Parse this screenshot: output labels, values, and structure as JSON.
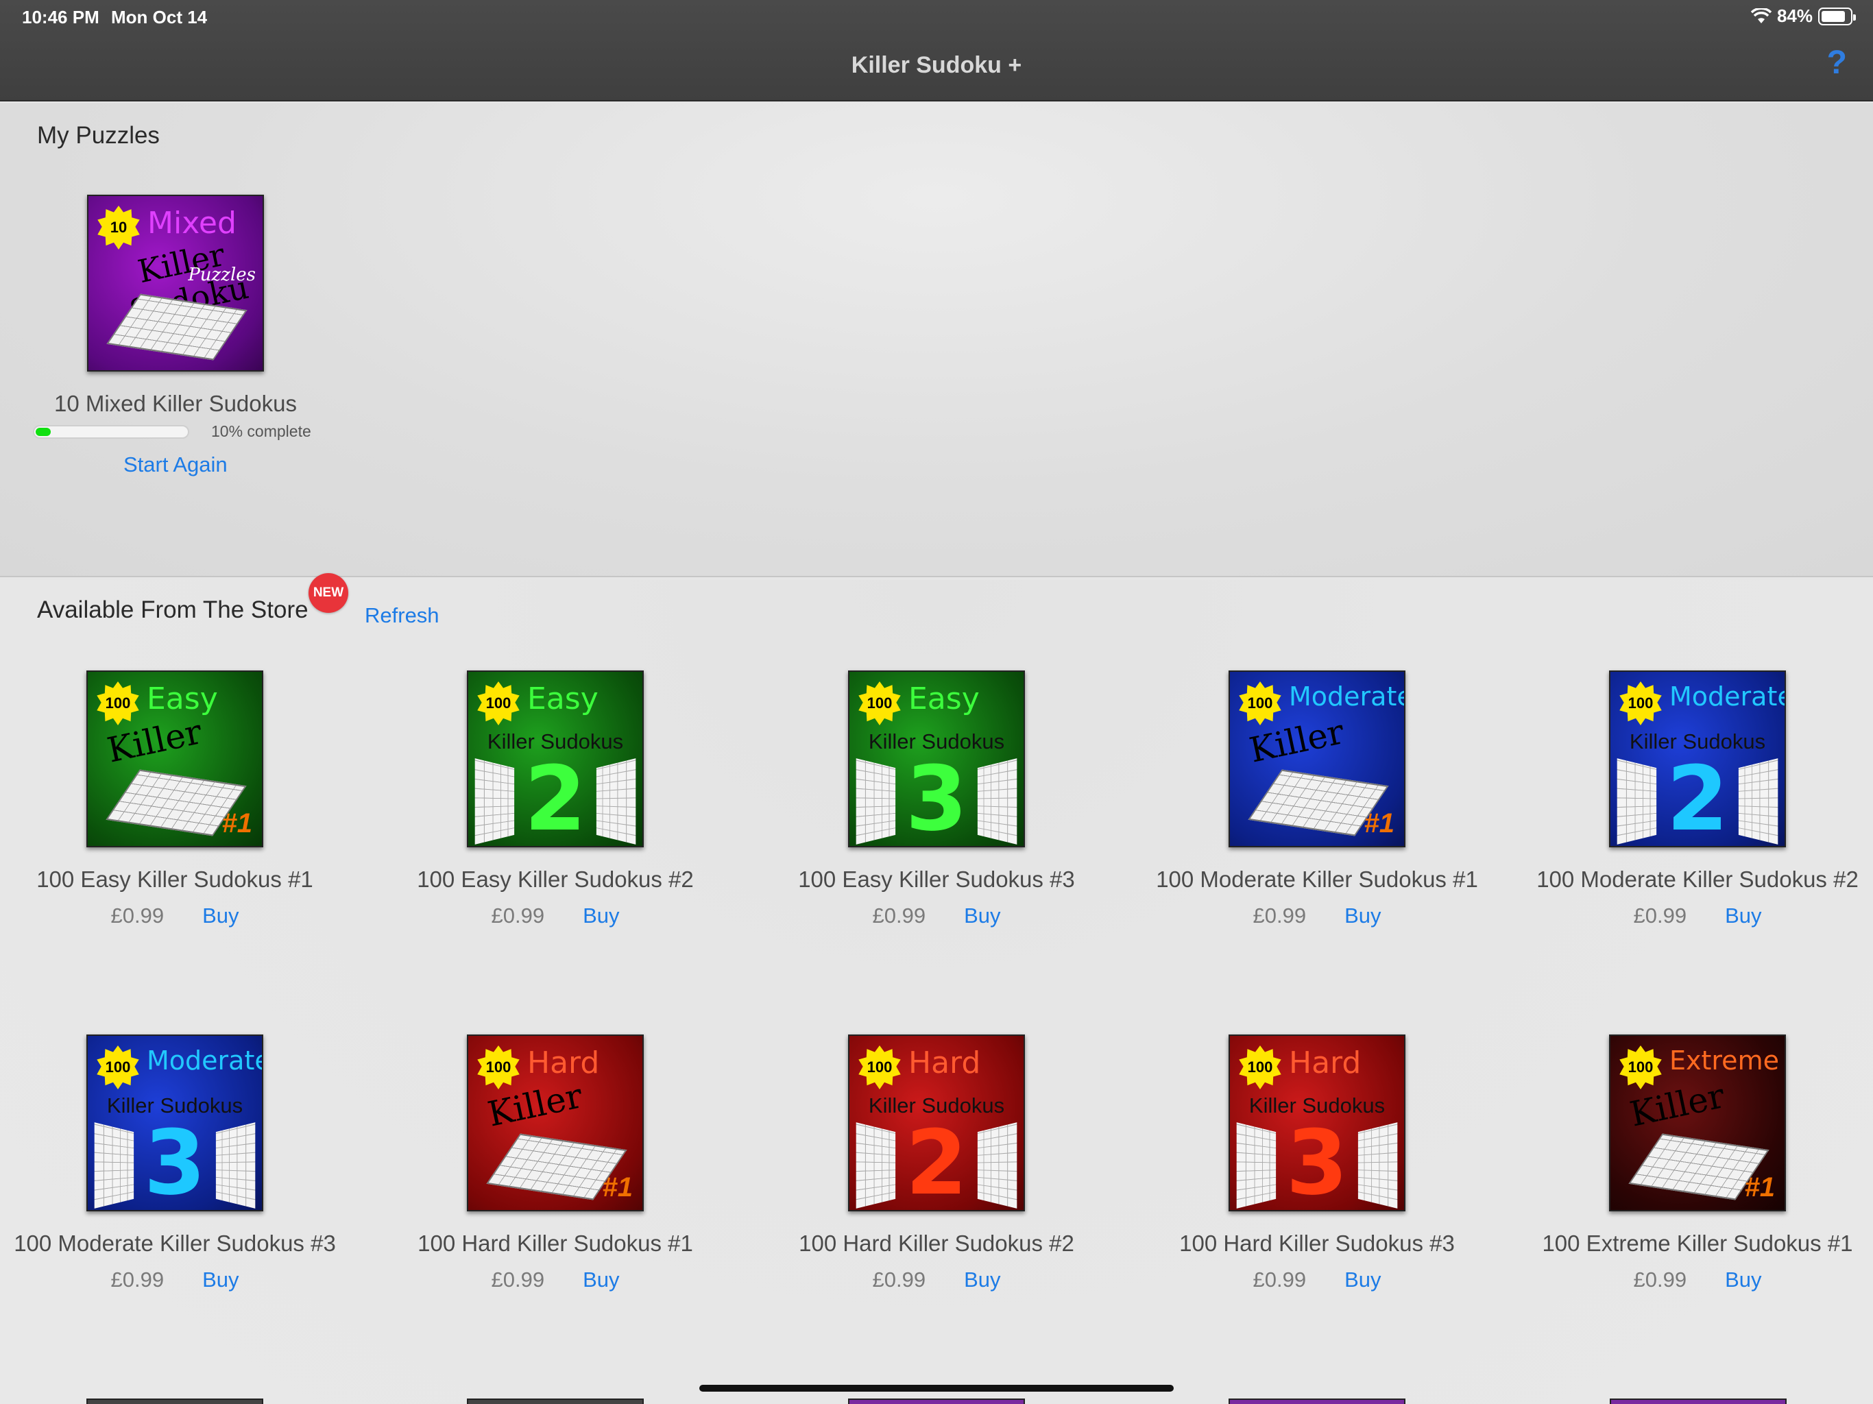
{
  "status_bar": {
    "time": "10:46 PM",
    "date": "Mon Oct 14",
    "battery": "84%",
    "battery_level": 0.84
  },
  "nav": {
    "title": "Killer Sudoku +",
    "help_label": "?"
  },
  "my_puzzles": {
    "title": "My Puzzles",
    "item": {
      "name": "10 Mixed Killer Sudokus",
      "cover": {
        "badge": "10",
        "level": "Mixed",
        "line": "Killer Sudoku",
        "sub": "Puzzles",
        "theme": "purple"
      },
      "progress": 0.1,
      "progress_label": "10% complete",
      "start_again": "Start Again"
    }
  },
  "store": {
    "title": "Available From The Store",
    "new_badge": "NEW",
    "refresh": "Refresh",
    "items": [
      {
        "name": "100 Easy Killer Sudokus #1",
        "price": "£0.99",
        "buy": "Buy",
        "cover": {
          "badge": "100",
          "level": "Easy",
          "style": "classic",
          "vol": "#1",
          "theme": "green"
        }
      },
      {
        "name": "100 Easy Killer Sudokus #2",
        "price": "£0.99",
        "buy": "Buy",
        "cover": {
          "badge": "100",
          "level": "Easy",
          "style": "number",
          "line": "Killer Sudokus",
          "vol": "2",
          "theme": "green"
        }
      },
      {
        "name": "100 Easy Killer Sudokus #3",
        "price": "£0.99",
        "buy": "Buy",
        "cover": {
          "badge": "100",
          "level": "Easy",
          "style": "number",
          "line": "Killer Sudokus",
          "vol": "3",
          "theme": "green"
        }
      },
      {
        "name": "100 Moderate Killer Sudokus #1",
        "price": "£0.99",
        "buy": "Buy",
        "cover": {
          "badge": "100",
          "level": "Moderate",
          "style": "classic",
          "vol": "#1",
          "theme": "blue"
        }
      },
      {
        "name": "100 Moderate Killer Sudokus #2",
        "price": "£0.99",
        "buy": "Buy",
        "cover": {
          "badge": "100",
          "level": "Moderate",
          "style": "number",
          "line": "Killer Sudokus",
          "vol": "2",
          "theme": "blue"
        }
      },
      {
        "name": "100 Moderate Killer Sudokus #3",
        "price": "£0.99",
        "buy": "Buy",
        "cover": {
          "badge": "100",
          "level": "Moderate",
          "style": "number",
          "line": "Killer Sudokus",
          "vol": "3",
          "theme": "blue"
        }
      },
      {
        "name": "100 Hard Killer Sudokus #1",
        "price": "£0.99",
        "buy": "Buy",
        "cover": {
          "badge": "100",
          "level": "Hard",
          "style": "classic",
          "vol": "#1",
          "theme": "red"
        }
      },
      {
        "name": "100 Hard Killer Sudokus #2",
        "price": "£0.99",
        "buy": "Buy",
        "cover": {
          "badge": "100",
          "level": "Hard",
          "style": "number",
          "line": "Killer Sudokus",
          "vol": "2",
          "theme": "red"
        }
      },
      {
        "name": "100 Hard Killer Sudokus #3",
        "price": "£0.99",
        "buy": "Buy",
        "cover": {
          "badge": "100",
          "level": "Hard",
          "style": "number",
          "line": "Killer Sudokus",
          "vol": "3",
          "theme": "red"
        }
      },
      {
        "name": "100 Extreme Killer Sudokus #1",
        "price": "£0.99",
        "buy": "Buy",
        "cover": {
          "badge": "100",
          "level": "Extreme",
          "style": "classic",
          "vol": "#1",
          "theme": "dark"
        }
      }
    ]
  },
  "colors": {
    "link": "#1c7be6",
    "nav_bar": "#444444",
    "new_badge": "#e8343a",
    "progress": "#10e010"
  }
}
